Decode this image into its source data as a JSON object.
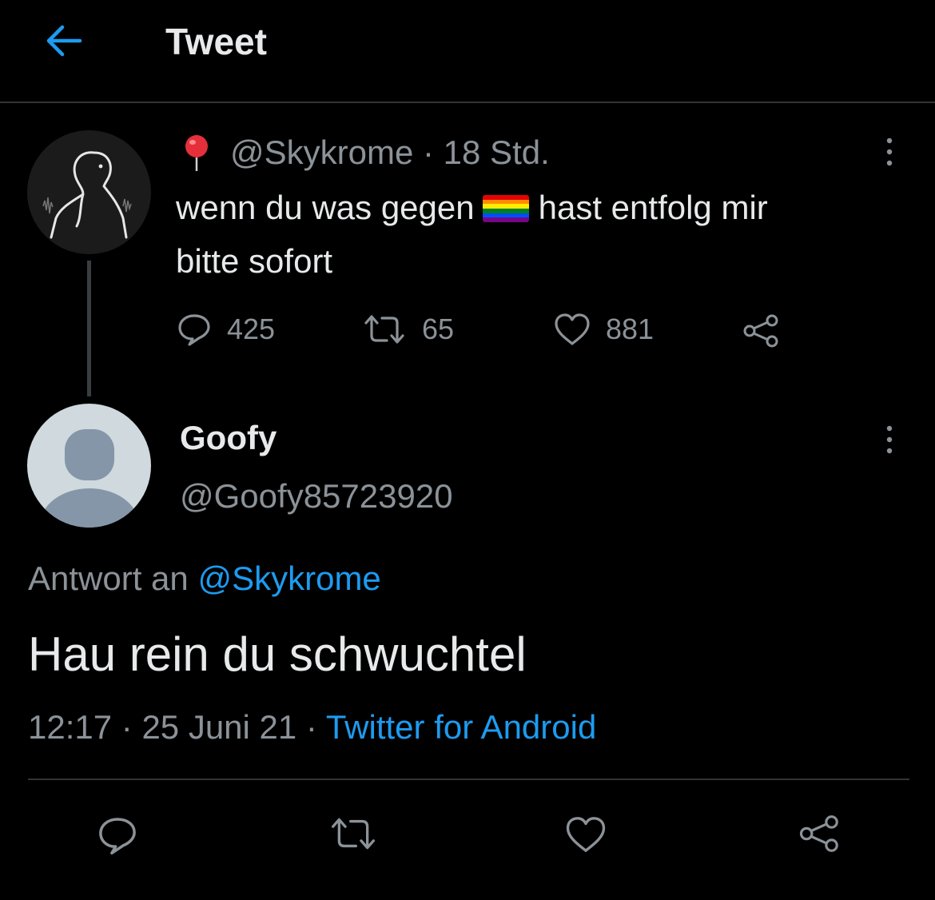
{
  "header": {
    "title": "Tweet"
  },
  "parent_tweet": {
    "handle": "@Skykrome",
    "separator": " · ",
    "time": "18 Std.",
    "text_before_flag": "wenn du was gegen",
    "flag_icon": "rainbow-flag-icon",
    "text_after_flag": "hast entfolg mir",
    "text_line2": "bitte sofort",
    "replies": "425",
    "retweets": "65",
    "likes": "881"
  },
  "reply_tweet": {
    "name": "Goofy",
    "handle": "@Goofy85723920",
    "reply_to_label": "Antwort an",
    "reply_to_handle": "@Skykrome",
    "text": "Hau rein du schwuchtel",
    "time": "12:17",
    "separator1": " · ",
    "date": "25 Juni 21",
    "separator2": " · ",
    "source": "Twitter for Android"
  },
  "colors": {
    "background": "#000000",
    "text": "#e7e9ea",
    "muted": "#8b9298",
    "accent": "#1d9bf0",
    "divider": "#2f3336"
  },
  "icons": {
    "back": "arrow-left-icon",
    "location": "pin-icon",
    "more": "more-vertical-icon",
    "reply": "speech-bubble-icon",
    "retweet": "retweet-icon",
    "like": "heart-icon",
    "share": "share-icon"
  }
}
